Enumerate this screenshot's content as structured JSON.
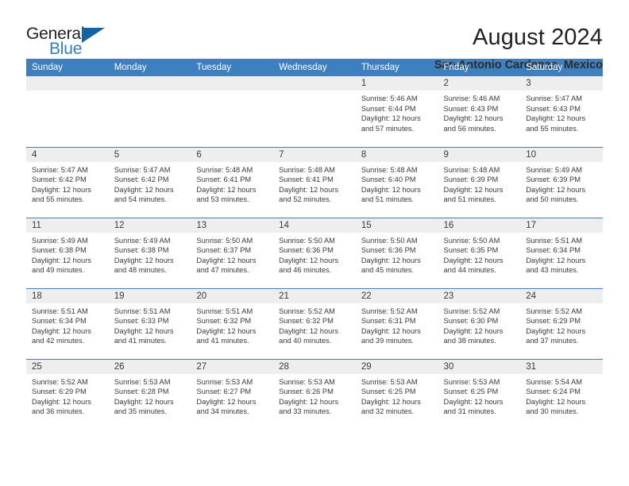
{
  "brand": {
    "name_part1": "General",
    "name_part2": "Blue"
  },
  "header": {
    "title": "August 2024",
    "subtitle": "San Antonio Cardenas, Mexico"
  },
  "weekday_headers": [
    "Sunday",
    "Monday",
    "Tuesday",
    "Wednesday",
    "Thursday",
    "Friday",
    "Saturday"
  ],
  "colors": {
    "header_blue": "#3d7fbf",
    "logo_blue": "#2e7fc1",
    "logo_triangle": "#1362a4",
    "daynum_bg": "#eeeeee"
  },
  "weeks": [
    [
      {
        "day": "",
        "empty": true
      },
      {
        "day": "",
        "empty": true
      },
      {
        "day": "",
        "empty": true
      },
      {
        "day": "",
        "empty": true
      },
      {
        "day": "1",
        "sunrise": "Sunrise: 5:46 AM",
        "sunset": "Sunset: 6:44 PM",
        "daylight1": "Daylight: 12 hours",
        "daylight2": "and 57 minutes."
      },
      {
        "day": "2",
        "sunrise": "Sunrise: 5:46 AM",
        "sunset": "Sunset: 6:43 PM",
        "daylight1": "Daylight: 12 hours",
        "daylight2": "and 56 minutes."
      },
      {
        "day": "3",
        "sunrise": "Sunrise: 5:47 AM",
        "sunset": "Sunset: 6:43 PM",
        "daylight1": "Daylight: 12 hours",
        "daylight2": "and 55 minutes."
      }
    ],
    [
      {
        "day": "4",
        "sunrise": "Sunrise: 5:47 AM",
        "sunset": "Sunset: 6:42 PM",
        "daylight1": "Daylight: 12 hours",
        "daylight2": "and 55 minutes."
      },
      {
        "day": "5",
        "sunrise": "Sunrise: 5:47 AM",
        "sunset": "Sunset: 6:42 PM",
        "daylight1": "Daylight: 12 hours",
        "daylight2": "and 54 minutes."
      },
      {
        "day": "6",
        "sunrise": "Sunrise: 5:48 AM",
        "sunset": "Sunset: 6:41 PM",
        "daylight1": "Daylight: 12 hours",
        "daylight2": "and 53 minutes."
      },
      {
        "day": "7",
        "sunrise": "Sunrise: 5:48 AM",
        "sunset": "Sunset: 6:41 PM",
        "daylight1": "Daylight: 12 hours",
        "daylight2": "and 52 minutes."
      },
      {
        "day": "8",
        "sunrise": "Sunrise: 5:48 AM",
        "sunset": "Sunset: 6:40 PM",
        "daylight1": "Daylight: 12 hours",
        "daylight2": "and 51 minutes."
      },
      {
        "day": "9",
        "sunrise": "Sunrise: 5:48 AM",
        "sunset": "Sunset: 6:39 PM",
        "daylight1": "Daylight: 12 hours",
        "daylight2": "and 51 minutes."
      },
      {
        "day": "10",
        "sunrise": "Sunrise: 5:49 AM",
        "sunset": "Sunset: 6:39 PM",
        "daylight1": "Daylight: 12 hours",
        "daylight2": "and 50 minutes."
      }
    ],
    [
      {
        "day": "11",
        "sunrise": "Sunrise: 5:49 AM",
        "sunset": "Sunset: 6:38 PM",
        "daylight1": "Daylight: 12 hours",
        "daylight2": "and 49 minutes."
      },
      {
        "day": "12",
        "sunrise": "Sunrise: 5:49 AM",
        "sunset": "Sunset: 6:38 PM",
        "daylight1": "Daylight: 12 hours",
        "daylight2": "and 48 minutes."
      },
      {
        "day": "13",
        "sunrise": "Sunrise: 5:50 AM",
        "sunset": "Sunset: 6:37 PM",
        "daylight1": "Daylight: 12 hours",
        "daylight2": "and 47 minutes."
      },
      {
        "day": "14",
        "sunrise": "Sunrise: 5:50 AM",
        "sunset": "Sunset: 6:36 PM",
        "daylight1": "Daylight: 12 hours",
        "daylight2": "and 46 minutes."
      },
      {
        "day": "15",
        "sunrise": "Sunrise: 5:50 AM",
        "sunset": "Sunset: 6:36 PM",
        "daylight1": "Daylight: 12 hours",
        "daylight2": "and 45 minutes."
      },
      {
        "day": "16",
        "sunrise": "Sunrise: 5:50 AM",
        "sunset": "Sunset: 6:35 PM",
        "daylight1": "Daylight: 12 hours",
        "daylight2": "and 44 minutes."
      },
      {
        "day": "17",
        "sunrise": "Sunrise: 5:51 AM",
        "sunset": "Sunset: 6:34 PM",
        "daylight1": "Daylight: 12 hours",
        "daylight2": "and 43 minutes."
      }
    ],
    [
      {
        "day": "18",
        "sunrise": "Sunrise: 5:51 AM",
        "sunset": "Sunset: 6:34 PM",
        "daylight1": "Daylight: 12 hours",
        "daylight2": "and 42 minutes."
      },
      {
        "day": "19",
        "sunrise": "Sunrise: 5:51 AM",
        "sunset": "Sunset: 6:33 PM",
        "daylight1": "Daylight: 12 hours",
        "daylight2": "and 41 minutes."
      },
      {
        "day": "20",
        "sunrise": "Sunrise: 5:51 AM",
        "sunset": "Sunset: 6:32 PM",
        "daylight1": "Daylight: 12 hours",
        "daylight2": "and 41 minutes."
      },
      {
        "day": "21",
        "sunrise": "Sunrise: 5:52 AM",
        "sunset": "Sunset: 6:32 PM",
        "daylight1": "Daylight: 12 hours",
        "daylight2": "and 40 minutes."
      },
      {
        "day": "22",
        "sunrise": "Sunrise: 5:52 AM",
        "sunset": "Sunset: 6:31 PM",
        "daylight1": "Daylight: 12 hours",
        "daylight2": "and 39 minutes."
      },
      {
        "day": "23",
        "sunrise": "Sunrise: 5:52 AM",
        "sunset": "Sunset: 6:30 PM",
        "daylight1": "Daylight: 12 hours",
        "daylight2": "and 38 minutes."
      },
      {
        "day": "24",
        "sunrise": "Sunrise: 5:52 AM",
        "sunset": "Sunset: 6:29 PM",
        "daylight1": "Daylight: 12 hours",
        "daylight2": "and 37 minutes."
      }
    ],
    [
      {
        "day": "25",
        "sunrise": "Sunrise: 5:52 AM",
        "sunset": "Sunset: 6:29 PM",
        "daylight1": "Daylight: 12 hours",
        "daylight2": "and 36 minutes."
      },
      {
        "day": "26",
        "sunrise": "Sunrise: 5:53 AM",
        "sunset": "Sunset: 6:28 PM",
        "daylight1": "Daylight: 12 hours",
        "daylight2": "and 35 minutes."
      },
      {
        "day": "27",
        "sunrise": "Sunrise: 5:53 AM",
        "sunset": "Sunset: 6:27 PM",
        "daylight1": "Daylight: 12 hours",
        "daylight2": "and 34 minutes."
      },
      {
        "day": "28",
        "sunrise": "Sunrise: 5:53 AM",
        "sunset": "Sunset: 6:26 PM",
        "daylight1": "Daylight: 12 hours",
        "daylight2": "and 33 minutes."
      },
      {
        "day": "29",
        "sunrise": "Sunrise: 5:53 AM",
        "sunset": "Sunset: 6:25 PM",
        "daylight1": "Daylight: 12 hours",
        "daylight2": "and 32 minutes."
      },
      {
        "day": "30",
        "sunrise": "Sunrise: 5:53 AM",
        "sunset": "Sunset: 6:25 PM",
        "daylight1": "Daylight: 12 hours",
        "daylight2": "and 31 minutes."
      },
      {
        "day": "31",
        "sunrise": "Sunrise: 5:54 AM",
        "sunset": "Sunset: 6:24 PM",
        "daylight1": "Daylight: 12 hours",
        "daylight2": "and 30 minutes."
      }
    ]
  ]
}
